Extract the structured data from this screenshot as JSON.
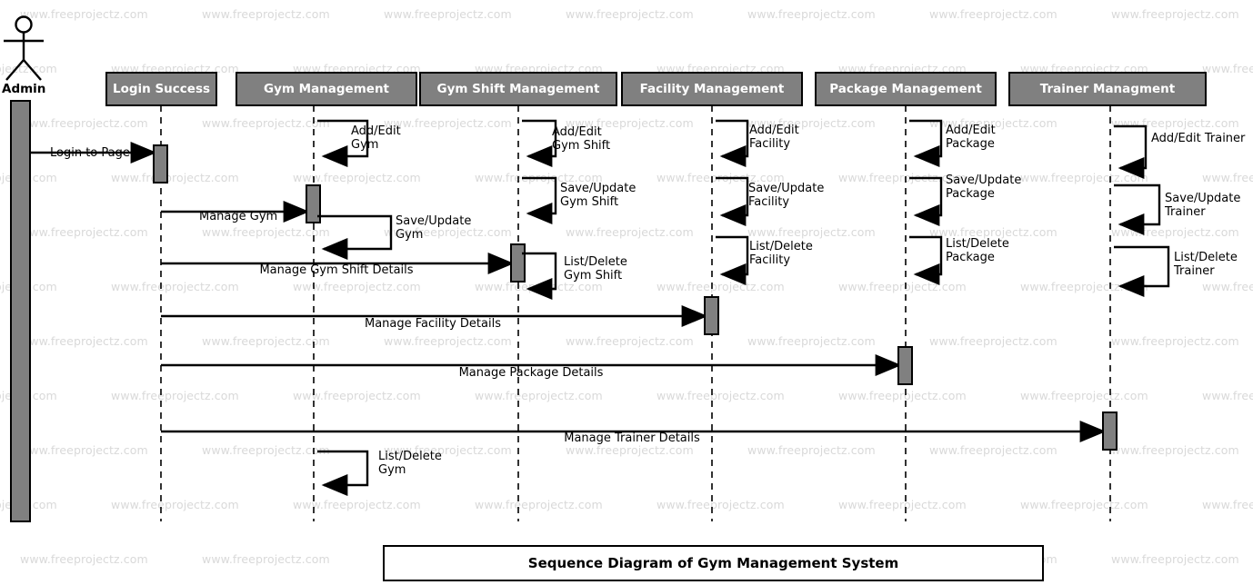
{
  "diagram": {
    "title": "Sequence Diagram of Gym Management System",
    "type": "uml-sequence-diagram",
    "actor": {
      "name": "Admin"
    },
    "colors": {
      "lifeline_header_fill": "#808080",
      "activation_fill": "#808080",
      "stroke": "#000000",
      "watermark": "#d9d9d9",
      "background": "#ffffff"
    },
    "watermark_text": "www.freeprojectz.com",
    "lifelines": [
      {
        "id": "login",
        "label": "Login Success"
      },
      {
        "id": "gym",
        "label": "Gym Management"
      },
      {
        "id": "gymshift",
        "label": "Gym Shift Management"
      },
      {
        "id": "facility",
        "label": "Facility Management"
      },
      {
        "id": "package",
        "label": "Package Management"
      },
      {
        "id": "trainer",
        "label": "Trainer Managment"
      }
    ],
    "messages": [
      {
        "from": "actor",
        "to": "login",
        "label": "Login to Page"
      },
      {
        "from": "actor",
        "to": "gym",
        "label": "Manage Gym"
      },
      {
        "from": "actor",
        "to": "gymshift",
        "label": "Manage Gym Shift Details"
      },
      {
        "from": "actor",
        "to": "facility",
        "label": "Manage Facility Details"
      },
      {
        "from": "actor",
        "to": "package",
        "label": "Manage Package Details"
      },
      {
        "from": "actor",
        "to": "trainer",
        "label": "Manage Trainer Details"
      }
    ],
    "self_messages": [
      {
        "lifeline": "gym",
        "label": "Add/Edit\nGym"
      },
      {
        "lifeline": "gym",
        "label": "Save/Update\nGym"
      },
      {
        "lifeline": "gym",
        "label": "List/Delete\nGym"
      },
      {
        "lifeline": "gymshift",
        "label": "Add/Edit\nGym Shift"
      },
      {
        "lifeline": "gymshift",
        "label": "Save/Update\nGym Shift"
      },
      {
        "lifeline": "gymshift",
        "label": "List/Delete\nGym Shift"
      },
      {
        "lifeline": "facility",
        "label": "Add/Edit\nFacility"
      },
      {
        "lifeline": "facility",
        "label": "Save/Update\nFacility"
      },
      {
        "lifeline": "facility",
        "label": "List/Delete\nFacility"
      },
      {
        "lifeline": "package",
        "label": "Add/Edit\nPackage"
      },
      {
        "lifeline": "package",
        "label": "Save/Update\nPackage"
      },
      {
        "lifeline": "package",
        "label": "List/Delete\nPackage"
      },
      {
        "lifeline": "trainer",
        "label": "Add/Edit Trainer"
      },
      {
        "lifeline": "trainer",
        "label": "Save/Update\nTrainer"
      },
      {
        "lifeline": "trainer",
        "label": "List/Delete\nTrainer"
      }
    ]
  }
}
